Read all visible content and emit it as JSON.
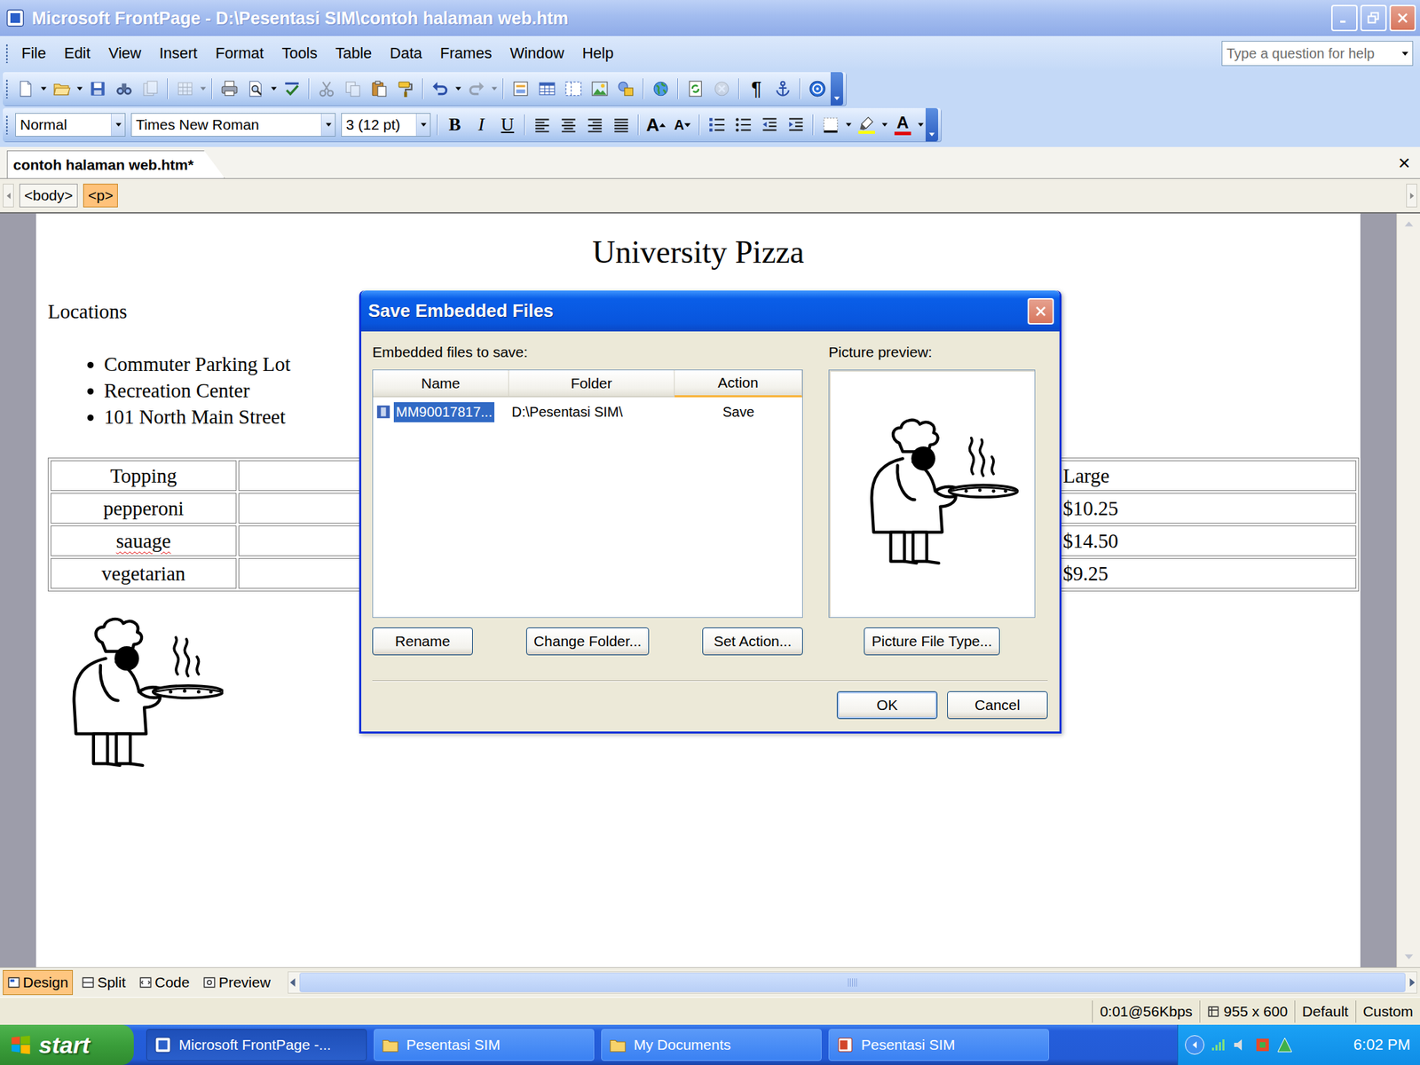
{
  "window": {
    "title": "Microsoft FrontPage - D:\\Pesentasi SIM\\contoh halaman web.htm"
  },
  "menu": [
    "File",
    "Edit",
    "View",
    "Insert",
    "Format",
    "Tools",
    "Table",
    "Data",
    "Frames",
    "Window",
    "Help"
  ],
  "help_box": {
    "placeholder": "Type a question for help"
  },
  "standard_toolbar": [
    {
      "disabled": false
    },
    {
      "disabled": false
    },
    {
      "disabled": false
    },
    {
      "disabled": false
    },
    {
      "disabled": true
    },
    {
      "disabled": true
    },
    {
      "disabled": false
    },
    {
      "disabled": false
    },
    {
      "disabled": false
    },
    {
      "disabled": true
    },
    {
      "disabled": true
    },
    {
      "disabled": false
    },
    {
      "disabled": false
    },
    {
      "disabled": false
    },
    {
      "disabled": true
    },
    {
      "disabled": false
    },
    {
      "disabled": false
    },
    {
      "disabled": false
    },
    {
      "disabled": false
    },
    {
      "disabled": false
    },
    {
      "disabled": false
    },
    {
      "disabled": false
    },
    {
      "disabled": true
    },
    {
      "disabled": false,
      "label": "¶"
    },
    {
      "disabled": false
    },
    {
      "disabled": false
    }
  ],
  "format_toolbar": {
    "style": "Normal",
    "font": "Times New Roman",
    "size": "3 (12 pt)",
    "text_buttons": [
      "B",
      "I",
      "U"
    ],
    "letter_icons": [
      "A",
      "A",
      "A"
    ]
  },
  "document_tabs": [
    {
      "label": "contoh halaman web.htm*",
      "selected": true
    }
  ],
  "close_glyph": "×",
  "tag_selector": [
    {
      "label": "<body>",
      "selected": false
    },
    {
      "label": "<p>",
      "selected": true
    }
  ],
  "page": {
    "heading": "University Pizza",
    "subheading": "Locations",
    "locations": [
      "Commuter Parking Lot",
      "Recreation Center",
      "101 North Main Street"
    ],
    "table": {
      "columns": [
        "Topping",
        "",
        "",
        "Large"
      ],
      "rows": [
        {
          "cells": [
            "pepperoni",
            "",
            "",
            "$10.25"
          ],
          "spelling_error": false
        },
        {
          "cells": [
            "sauage",
            "",
            "",
            "$14.50"
          ],
          "spelling_error": true
        },
        {
          "cells": [
            "vegetarian",
            "",
            "",
            "$9.25"
          ],
          "spelling_error": false
        }
      ]
    }
  },
  "view_tabs": [
    {
      "label": "Design",
      "selected": true
    },
    {
      "label": "Split",
      "selected": false
    },
    {
      "label": "Code",
      "selected": false
    },
    {
      "label": "Preview",
      "selected": false
    }
  ],
  "status_bar": [
    "0:01@56Kbps",
    "955 x 600",
    "Default",
    "Custom"
  ],
  "dialog": {
    "title": "Save Embedded Files",
    "list_label": "Embedded files to save:",
    "columns": [
      {
        "label": "Name",
        "sorted": false
      },
      {
        "label": "Folder",
        "sorted": false
      },
      {
        "label": "Action",
        "sorted": true
      }
    ],
    "files": [
      {
        "name": "MM90017817...",
        "folder": "D:\\Pesentasi SIM\\",
        "action": "Save",
        "selected": true
      }
    ],
    "preview_label": "Picture preview:",
    "list_buttons": [
      "Rename",
      "Change Folder...",
      "Set Action..."
    ],
    "preview_button": "Picture File Type...",
    "buttons": [
      {
        "label": "OK",
        "default": true
      },
      {
        "label": "Cancel",
        "default": false
      }
    ]
  },
  "taskbar": {
    "start": "start",
    "tasks": [
      {
        "label": "Microsoft FrontPage -...",
        "selected": true,
        "kind": "app"
      },
      {
        "label": "Pesentasi SIM",
        "selected": false,
        "kind": "folder"
      },
      {
        "label": "My Documents",
        "selected": false,
        "kind": "folder"
      },
      {
        "label": "Pesentasi SIM",
        "selected": false,
        "kind": "presentation"
      }
    ],
    "clock": "6:02 PM"
  }
}
